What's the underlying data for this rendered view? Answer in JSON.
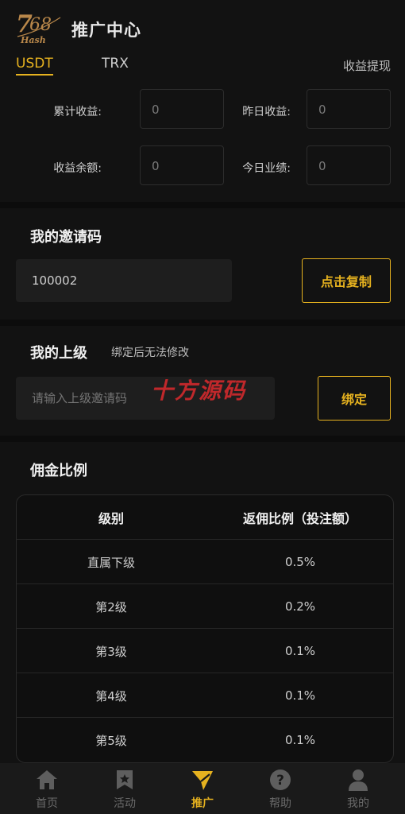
{
  "header": {
    "logo_text": "768 Hash",
    "title": "推广中心"
  },
  "tabs": [
    {
      "label": "USDT",
      "active": true
    },
    {
      "label": "TRX",
      "active": false
    }
  ],
  "withdraw_label": "收益提现",
  "stats": {
    "total_earnings": {
      "label": "累计收益:",
      "value": "0"
    },
    "yesterday_earnings": {
      "label": "昨日收益:",
      "value": "0"
    },
    "balance": {
      "label": "收益余额:",
      "value": "0"
    },
    "today_performance": {
      "label": "今日业绩:",
      "value": "0"
    }
  },
  "invite": {
    "title": "我的邀请码",
    "code": "100002",
    "copy_label": "点击复制"
  },
  "superior": {
    "title": "我的上级",
    "hint": "绑定后无法修改",
    "placeholder": "请输入上级邀请码",
    "bind_label": "绑定",
    "watermark": "十方源码"
  },
  "commission": {
    "title": "佣金比例",
    "columns": [
      "级别",
      "返佣比例（投注额）"
    ],
    "rows": [
      [
        "直属下级",
        "0.5%"
      ],
      [
        "第2级",
        "0.2%"
      ],
      [
        "第3级",
        "0.1%"
      ],
      [
        "第4级",
        "0.1%"
      ],
      [
        "第5级",
        "0.1%"
      ]
    ]
  },
  "nav": [
    {
      "label": "首页",
      "icon": "home-icon",
      "active": false
    },
    {
      "label": "活动",
      "icon": "bookmark-icon",
      "active": false
    },
    {
      "label": "推广",
      "icon": "send-icon",
      "active": true
    },
    {
      "label": "帮助",
      "icon": "help-icon",
      "active": false
    },
    {
      "label": "我的",
      "icon": "user-icon",
      "active": false
    }
  ],
  "colors": {
    "accent": "#e6b21f",
    "background": "#0c0c0c",
    "card": "#121212",
    "watermark": "#c0282b"
  }
}
